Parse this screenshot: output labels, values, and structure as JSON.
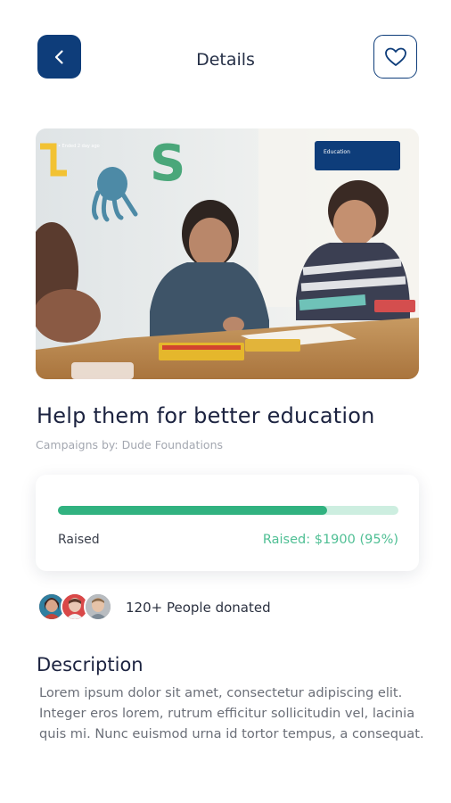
{
  "header": {
    "title": "Details",
    "back_icon": "chevron-left-icon",
    "favorite_icon": "heart-outline-icon"
  },
  "hero": {
    "tag": "• Ended 2 day ago",
    "category": "Education"
  },
  "campaign": {
    "title": "Help them for better education",
    "byline": "Campaigns by: Dude Foundations"
  },
  "progress": {
    "label": "Raised",
    "value_text": "Raised: $1900 (95%)",
    "percent": 0.79,
    "fill_color": "#31b280",
    "track_color": "#cdeee0"
  },
  "donors": {
    "text": "120+ People donated"
  },
  "description": {
    "heading": "Description",
    "body": "Lorem ipsum dolor sit amet, consectetur adipiscing elit. Integer eros lorem, rutrum efficitur sollicitudin vel, lacinia quis mi. Nunc euismod urna id tortor tempus, a consequat."
  },
  "colors": {
    "primary": "#0e3d7a",
    "accent": "#31b280"
  }
}
